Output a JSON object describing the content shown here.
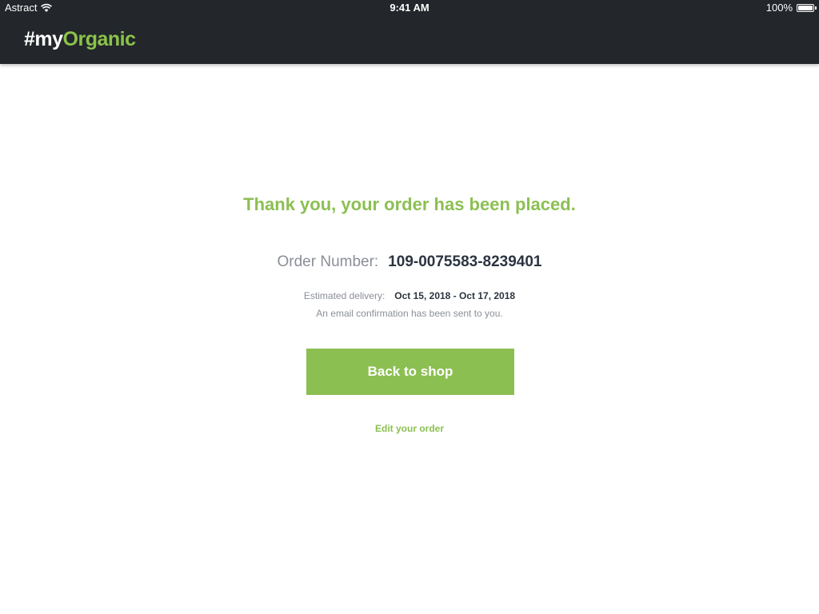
{
  "status_bar": {
    "carrier": "Astract",
    "time": "9:41 AM",
    "battery": "100%",
    "wifi_icon": "wifi-icon",
    "battery_icon": "battery-icon"
  },
  "header": {
    "logo_prefix": "#my",
    "logo_suffix": "Organic",
    "background_color": "#23262b",
    "accent_color": "#8cbf52"
  },
  "confirmation": {
    "title": "Thank you, your order has been placed.",
    "order_number_label": "Order Number:",
    "order_number": "109-0075583-8239401",
    "delivery_label": "Estimated delivery:",
    "delivery_dates": "Oct 15, 2018 - Oct 17, 2018",
    "email_note": "An email confirmation has been sent to you.",
    "back_button_label": "Back to shop",
    "edit_link_label": "Edit your order"
  }
}
